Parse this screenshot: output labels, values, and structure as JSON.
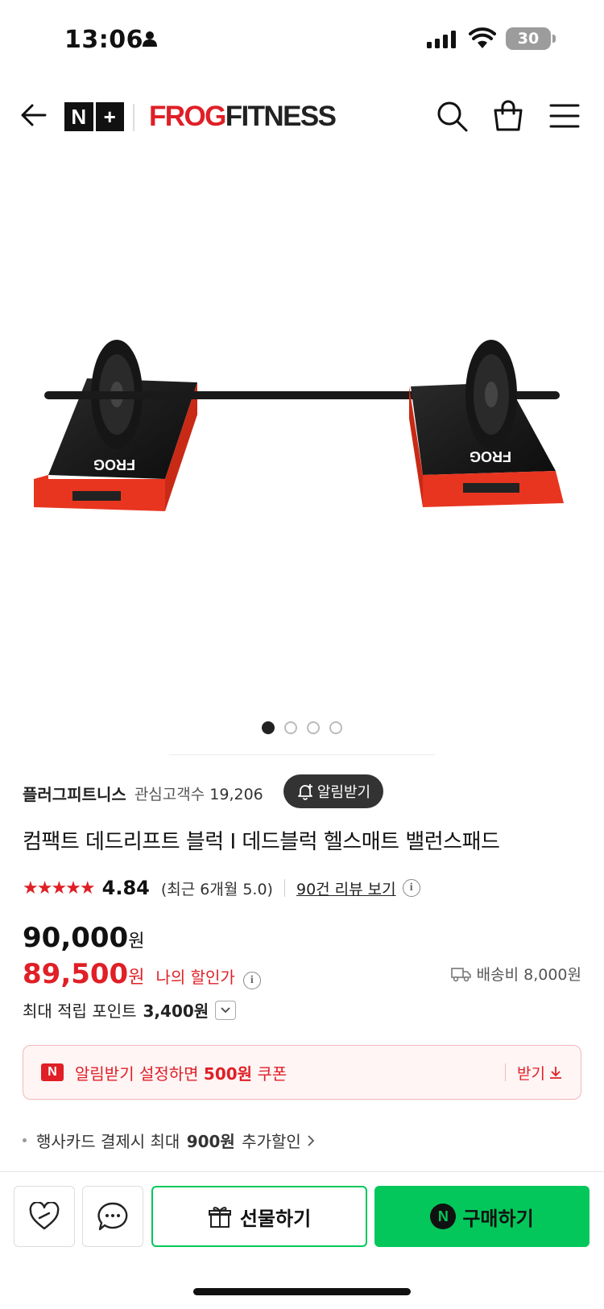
{
  "status_bar": {
    "time": "13:06",
    "battery": "30"
  },
  "header": {
    "nplus_left": "N",
    "nplus_right": "+",
    "brand_red": "FROG",
    "brand_black": "FITNESS"
  },
  "gallery": {
    "pages": 4,
    "current": 1
  },
  "store": {
    "name": "플러그피트니스",
    "fans_label": "관심고객수",
    "fans_count": "19,206",
    "alarm_label": "알림받기"
  },
  "product": {
    "title": "컴팩트 데드리프트 블럭 I 데드블럭 헬스매트 밸런스패드",
    "stars": "★★★★★",
    "rating": "4.84",
    "recent_rating": "(최근 6개월 5.0)",
    "reviews_link": "90건 리뷰 보기",
    "original_price": "90,000",
    "sale_price": "89,500",
    "currency": "원",
    "my_discount_label": "나의 할인가",
    "shipping": "배송비 8,000원",
    "points_label": "최대 적립 포인트",
    "points_value": "3,400원"
  },
  "coupon": {
    "badge": "N",
    "text_prefix": "알림받기 설정하면",
    "text_amount": "500원",
    "text_suffix": "쿠폰",
    "get_label": "받기"
  },
  "benefits": [
    {
      "prefix": "행사카드 결제시 최대",
      "amount": "900원",
      "suffix": "추가할인"
    }
  ],
  "bottom_bar": {
    "gift_label": "선물하기",
    "buy_label": "구매하기",
    "buy_logo": "N"
  },
  "colors": {
    "accent_red": "#e01f26",
    "naver_green": "#03c75a"
  }
}
